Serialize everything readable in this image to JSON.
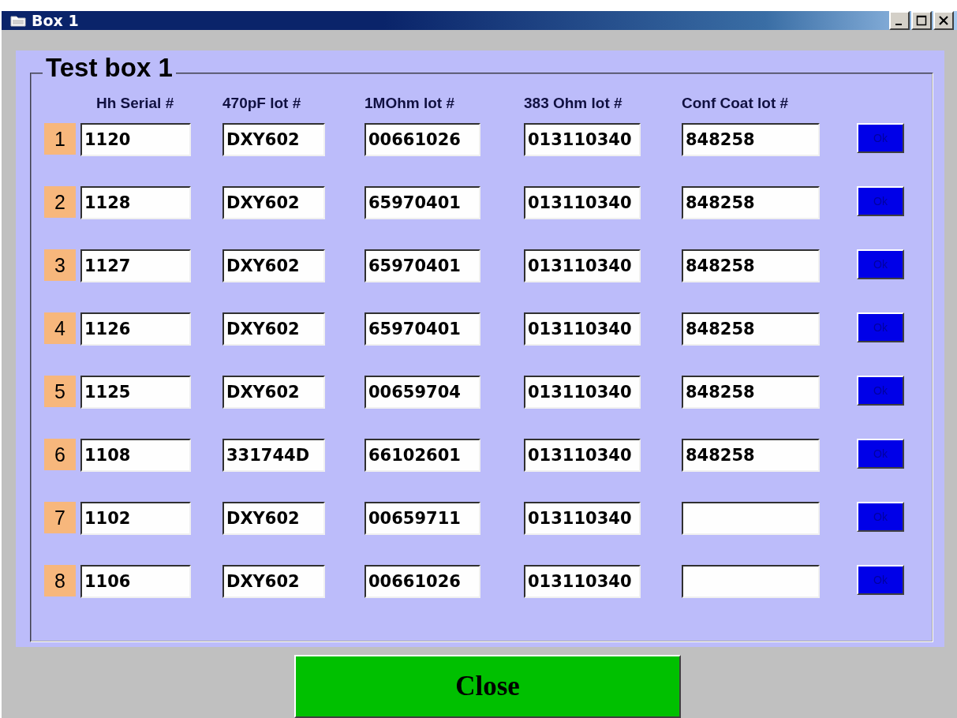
{
  "window": {
    "title": "Box 1"
  },
  "group": {
    "title": "Test box 1"
  },
  "columns": [
    "Hh Serial #",
    "470pF lot #",
    "1MOhm lot #",
    "383 Ohm lot #",
    "Conf Coat lot #"
  ],
  "rows": [
    {
      "number": "1",
      "hh_serial": "1120",
      "lot_470pf": "DXY602",
      "lot_1mohm": "00661026",
      "lot_383ohm": "013110340",
      "conf_coat_lot": "848258",
      "button": "Ok"
    },
    {
      "number": "2",
      "hh_serial": "1128",
      "lot_470pf": "DXY602",
      "lot_1mohm": "65970401",
      "lot_383ohm": "013110340",
      "conf_coat_lot": "848258",
      "button": "Ok"
    },
    {
      "number": "3",
      "hh_serial": "1127",
      "lot_470pf": "DXY602",
      "lot_1mohm": "65970401",
      "lot_383ohm": "013110340",
      "conf_coat_lot": "848258",
      "button": "Ok"
    },
    {
      "number": "4",
      "hh_serial": "1126",
      "lot_470pf": "DXY602",
      "lot_1mohm": "65970401",
      "lot_383ohm": "013110340",
      "conf_coat_lot": "848258",
      "button": "Ok"
    },
    {
      "number": "5",
      "hh_serial": "1125",
      "lot_470pf": "DXY602",
      "lot_1mohm": "00659704",
      "lot_383ohm": "013110340",
      "conf_coat_lot": "848258",
      "button": "Ok"
    },
    {
      "number": "6",
      "hh_serial": "1108",
      "lot_470pf": "331744D",
      "lot_1mohm": "66102601",
      "lot_383ohm": "013110340",
      "conf_coat_lot": "848258",
      "button": "Ok"
    },
    {
      "number": "7",
      "hh_serial": "1102",
      "lot_470pf": "DXY602",
      "lot_1mohm": "00659711",
      "lot_383ohm": "013110340",
      "button": "Ok"
    },
    {
      "number": "8",
      "hh_serial": "1106",
      "lot_470pf": "DXY602",
      "lot_1mohm": "00661026",
      "lot_383ohm": "013110340",
      "button": "Ok"
    }
  ],
  "close_button": "Close"
}
